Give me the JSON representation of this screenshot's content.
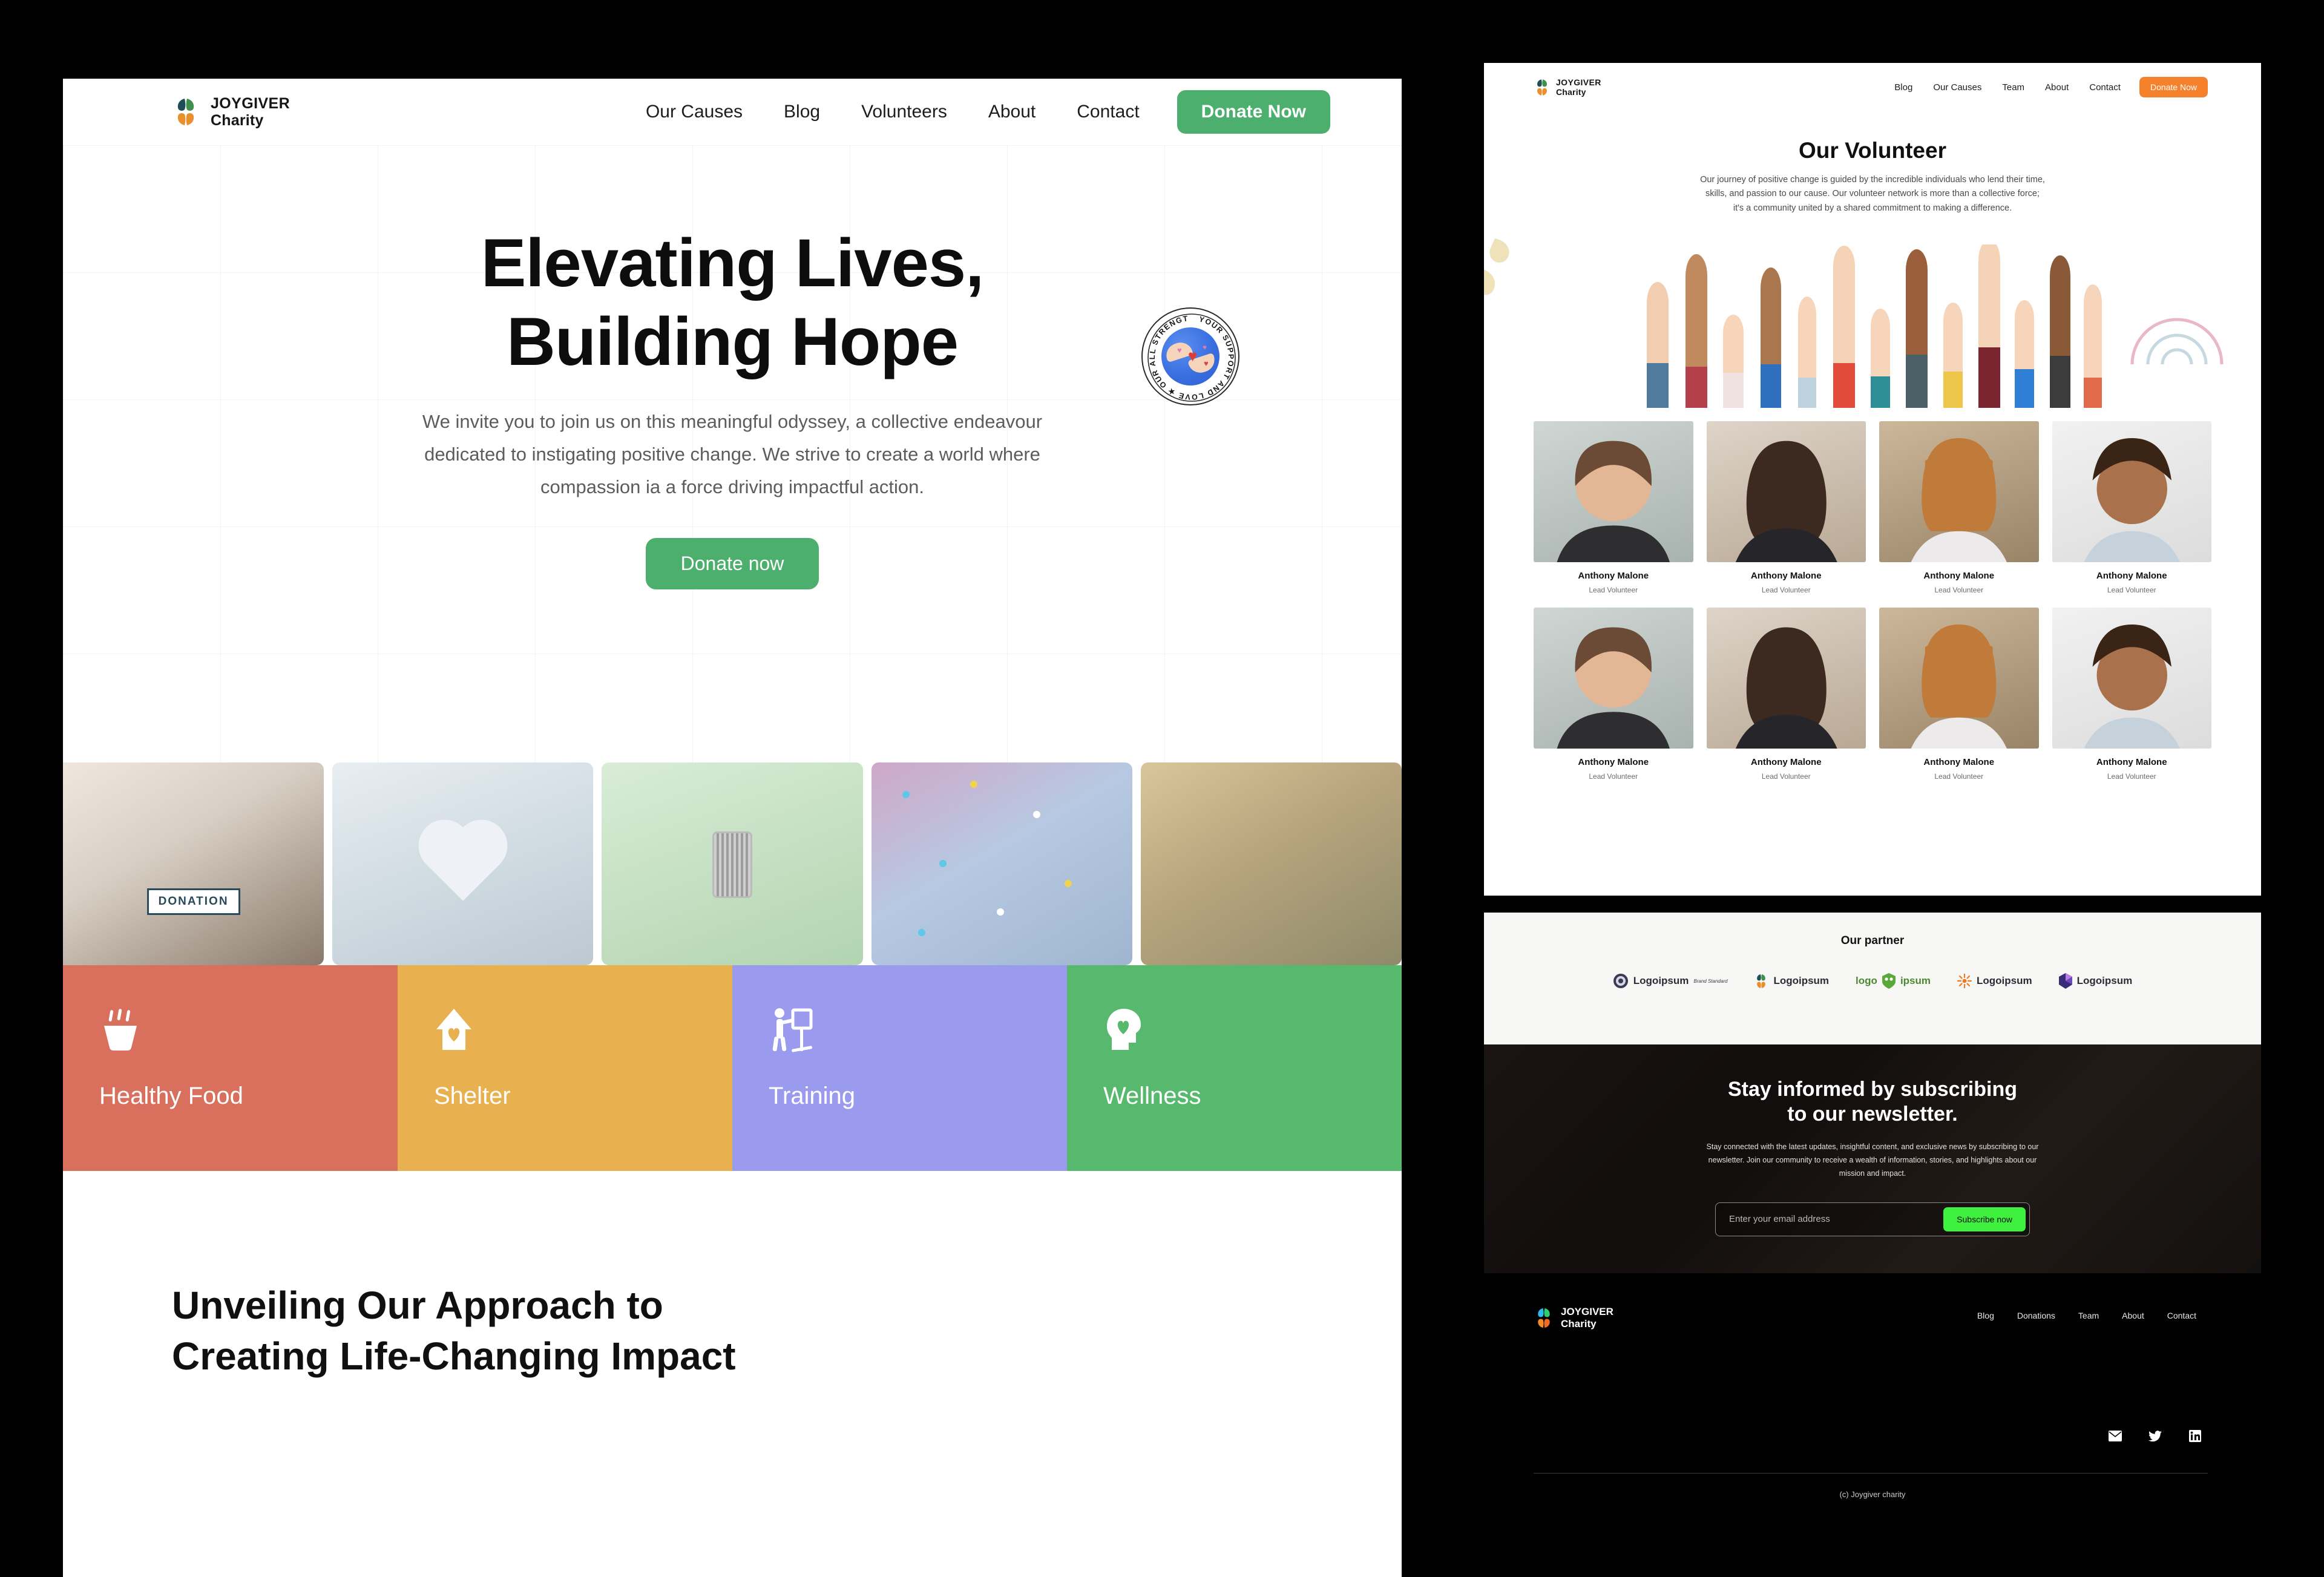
{
  "brand": {
    "name_line1": "JOYGIVER",
    "name_line2": "Charity",
    "logo_icon": "four-leaf-logo-icon",
    "colors": {
      "green": "#4caf6d",
      "orange": "#f5812c",
      "bright_green": "#3ff03f",
      "teal": "#1f4e56"
    }
  },
  "left_panel": {
    "nav": {
      "items": [
        {
          "label": "Our Causes"
        },
        {
          "label": "Blog"
        },
        {
          "label": "Volunteers"
        },
        {
          "label": "About"
        },
        {
          "label": "Contact"
        }
      ],
      "cta_label": "Donate Now"
    },
    "hero": {
      "heading_line1": "Elevating Lives,",
      "heading_line2": "Building Hope",
      "paragraph": "We invite you to join us on this meaningful odyssey, a collective endeavour dedicated to instigating positive change. We strive to create a world where compassion ia a force driving impactful action.",
      "cta_label": "Donate now",
      "badge": {
        "text": "YOUR SUPPORT AND LOVE ★ OUR ALL STRENGTH ★",
        "icon": "globe-hands-heart-seal-icon"
      }
    },
    "photos": [
      {
        "caption": "DONATION",
        "alt": "volunteer handing donation box",
        "icon": "donation-box-photo"
      },
      {
        "caption": "",
        "alt": "hands holding paper heart",
        "icon": "hands-heart-photo"
      },
      {
        "caption": "",
        "alt": "hand holding canned food",
        "icon": "canned-food-photo"
      },
      {
        "caption": "",
        "alt": "friends lying in circle with confetti",
        "icon": "friends-circle-photo"
      },
      {
        "caption": "",
        "alt": "group of friends laughing outdoors",
        "icon": "friends-outdoor-photo"
      }
    ],
    "categories": [
      {
        "label": "Healthy Food",
        "color": "#d9705e",
        "icon": "soup-bowl-icon"
      },
      {
        "label": "Shelter",
        "color": "#e8b04e",
        "icon": "house-heart-icon"
      },
      {
        "label": "Training",
        "color": "#9a9aef",
        "icon": "teaching-board-icon"
      },
      {
        "label": "Wellness",
        "color": "#57b96d",
        "icon": "head-heart-icon"
      }
    ],
    "approach": {
      "heading_line1": "Unveiling Our Approach to",
      "heading_line2": "Creating Life-Changing Impact"
    }
  },
  "right_top_panel": {
    "nav": {
      "items": [
        {
          "label": "Blog"
        },
        {
          "label": "Our Causes"
        },
        {
          "label": "Team"
        },
        {
          "label": "About"
        },
        {
          "label": "Contact"
        }
      ],
      "cta_label": "Donate Now"
    },
    "volunteer_section": {
      "title": "Our Volunteer",
      "description": "Our journey of positive change is guided by the incredible individuals who lend their time, skills, and passion to our cause. Our volunteer network is more than a collective force; it's a community united by a shared commitment to making a difference.",
      "hero_image_alt": "raised hands of diverse volunteers",
      "decorations": [
        "leaf-splash-decoration",
        "rainbow-arc-decoration"
      ]
    },
    "volunteers": [
      {
        "name": "Anthony Malone",
        "role": "Lead Volunteer"
      },
      {
        "name": "Anthony Malone",
        "role": "Lead Volunteer"
      },
      {
        "name": "Anthony Malone",
        "role": "Lead Volunteer"
      },
      {
        "name": "Anthony Malone",
        "role": "Lead Volunteer"
      },
      {
        "name": "Anthony Malone",
        "role": "Lead Volunteer"
      },
      {
        "name": "Anthony Malone",
        "role": "Lead Volunteer"
      },
      {
        "name": "Anthony Malone",
        "role": "Lead Volunteer"
      },
      {
        "name": "Anthony Malone",
        "role": "Lead Volunteer"
      }
    ]
  },
  "right_bottom_panel": {
    "partners": {
      "title": "Our partner",
      "logos": [
        {
          "name": "Logoipsum",
          "sub": "Brand Standard",
          "icon": "disc-logo-icon"
        },
        {
          "name": "Logoipsum",
          "sub": "",
          "icon": "leaf-logo-icon"
        },
        {
          "name": "logo ipsum",
          "sub": "",
          "icon": "shield-owl-logo-icon"
        },
        {
          "name": "Logoipsum",
          "sub": "",
          "icon": "sunburst-logo-icon"
        },
        {
          "name": "Logoipsum",
          "sub": "",
          "icon": "gem-logo-icon"
        }
      ]
    },
    "newsletter": {
      "heading_line1": "Stay informed by subscribing",
      "heading_line2": "to our newsletter.",
      "description": "Stay connected with the latest updates, insightful content, and exclusive news by subscribing to our newsletter. Join our community to receive a wealth of information, stories, and highlights about our mission and impact.",
      "email_placeholder": "Enter your email address",
      "email_value": "",
      "submit_label": "Subscribe now",
      "background_alt": "children lying in a circle"
    },
    "footer": {
      "nav": [
        {
          "label": "Blog"
        },
        {
          "label": "Donations"
        },
        {
          "label": "Team"
        },
        {
          "label": "About"
        },
        {
          "label": "Contact"
        }
      ],
      "socials": [
        {
          "name": "mail-icon",
          "glyph": "✉"
        },
        {
          "name": "twitter-icon",
          "glyph": "🐦"
        },
        {
          "name": "linkedin-icon",
          "glyph": "in"
        }
      ],
      "copyright": "(c) Joygiver charity"
    }
  }
}
